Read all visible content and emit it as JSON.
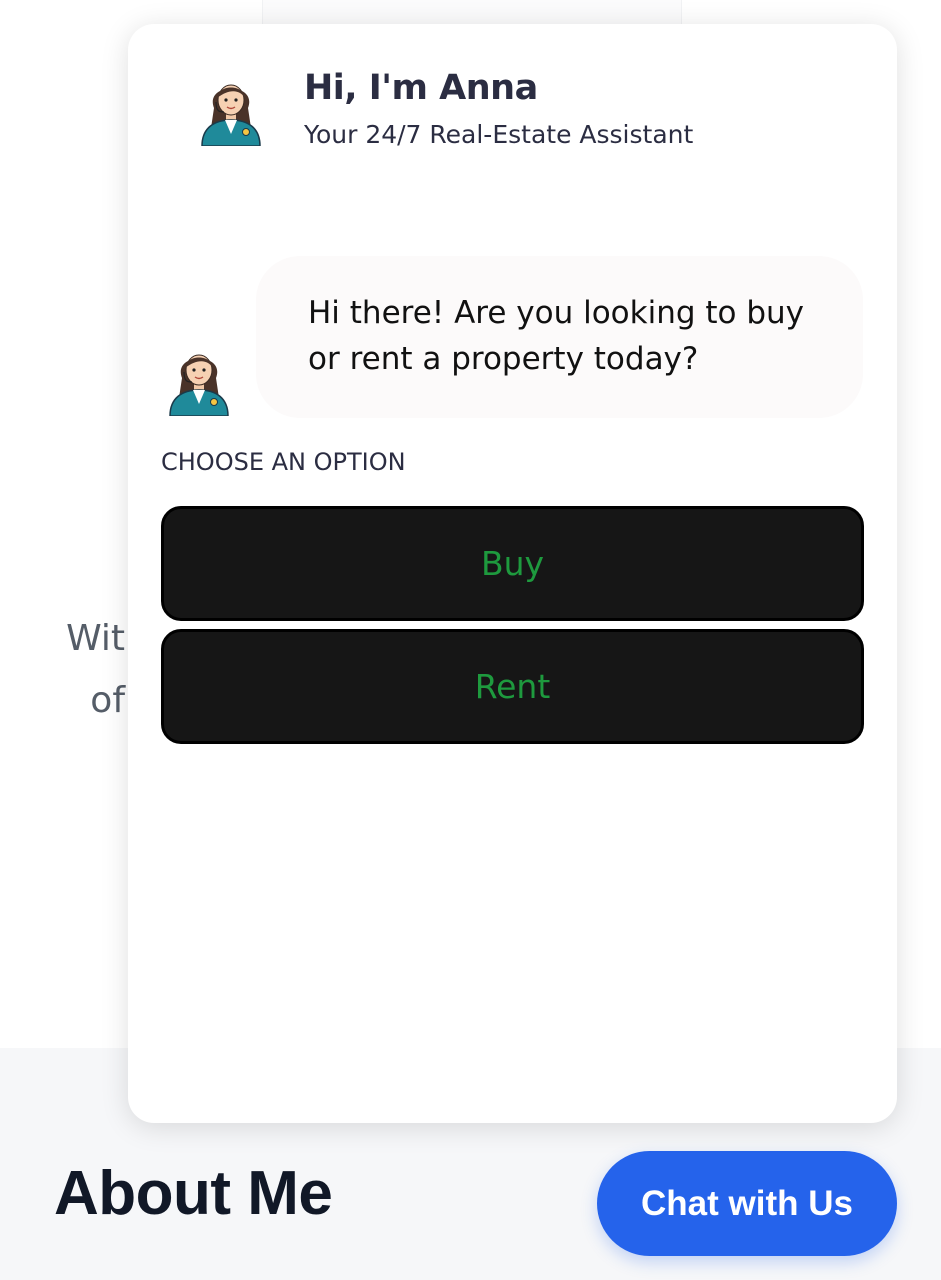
{
  "background": {
    "text_line_1": "Wit",
    "text_line_2": "of",
    "about_heading": "About Me"
  },
  "launcher": {
    "label": "Chat with Us"
  },
  "chat": {
    "assistant_name": "Hi, I'm Anna",
    "assistant_subtitle": "Your 24/7 Real-Estate Assistant",
    "message": "Hi there! Are you looking to buy or rent a property today?",
    "choose_label": "CHOOSE AN OPTION",
    "options": [
      {
        "label": "Buy"
      },
      {
        "label": "Rent"
      }
    ]
  },
  "colors": {
    "launcher_bg": "#2563eb",
    "option_bg": "#161616",
    "option_text": "#1e9a3e",
    "heading_text": "#2b2d42"
  }
}
